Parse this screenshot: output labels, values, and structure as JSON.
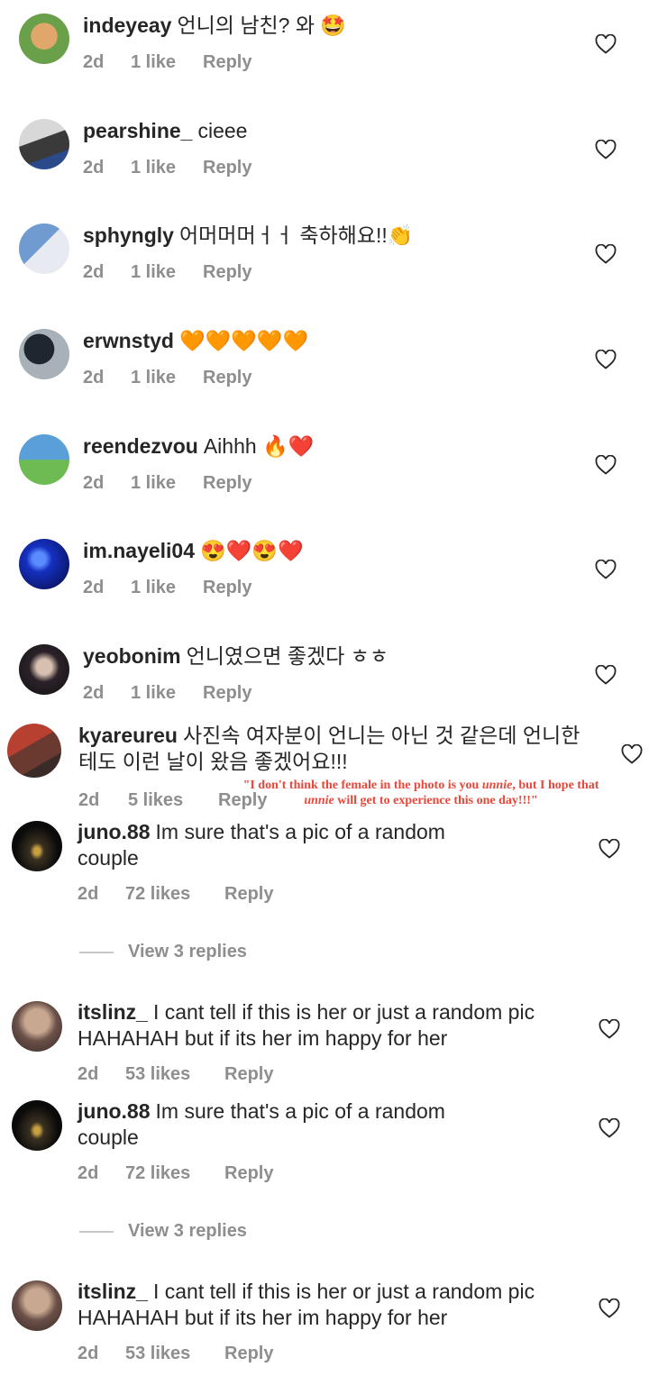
{
  "comments": [
    {
      "user": "indeyeay",
      "text": "언니의 남친? 와 🤩",
      "time": "2d",
      "likes": "1 like",
      "reply": "Reply"
    },
    {
      "user": "pearshine_",
      "text": "cieee",
      "time": "2d",
      "likes": "1 like",
      "reply": "Reply"
    },
    {
      "user": "sphyngly",
      "text": "어머머머ㅓㅓ 축하해요!!👏",
      "time": "2d",
      "likes": "1 like",
      "reply": "Reply"
    },
    {
      "user": "erwnstyd",
      "text": "🧡🧡🧡🧡🧡",
      "time": "2d",
      "likes": "1 like",
      "reply": "Reply"
    },
    {
      "user": "reendezvou",
      "text": "Aihhh 🔥❤️",
      "time": "2d",
      "likes": "1 like",
      "reply": "Reply"
    },
    {
      "user": "im.nayeli04",
      "text": "😍❤️😍❤️",
      "time": "2d",
      "likes": "1 like",
      "reply": "Reply"
    },
    {
      "user": "yeobonim",
      "text": "언니였으면 좋겠다 ㅎㅎ",
      "time": "2d",
      "likes": "1 like",
      "reply": "Reply"
    },
    {
      "user": "kyareureu",
      "text": "사진속 여자분이 언니는 아닌 것 같은데 언니한테도 이런 날이 왔음 좋겠어요!!!",
      "time": "2d",
      "likes": "5 likes",
      "reply": "Reply"
    },
    {
      "user": "juno.88",
      "text": "Im sure that's a pic of a random couple",
      "time": "2d",
      "likes": "72 likes",
      "reply": "Reply"
    },
    {
      "user": "itslinz_",
      "text": "I cant tell if this is her or just a random pic HAHAHAH but if its her im happy for her",
      "time": "2d",
      "likes": "53 likes",
      "reply": "Reply"
    },
    {
      "user": "juno.88",
      "text": "Im sure that's a pic of a random couple",
      "time": "2d",
      "likes": "72 likes",
      "reply": "Reply"
    },
    {
      "user": "itslinz_",
      "text": "I cant tell if this is her or just a random pic HAHAHAH but if its her im happy for her",
      "time": "2d",
      "likes": "53 likes",
      "reply": "Reply"
    }
  ],
  "view_replies": [
    "View 3 replies",
    "View 3 replies"
  ],
  "translation": {
    "line1_a": "\"I don't think the female in the photo is you ",
    "line1_em": "unnie",
    "line1_b": ", but I hope that",
    "line2_em": "unnie",
    "line2_b": " will get to experience this one day!!!\""
  },
  "colors": {
    "text": "#262626",
    "meta": "#8e8e8e",
    "annotation": "#e8473a",
    "heart": "#262626"
  }
}
